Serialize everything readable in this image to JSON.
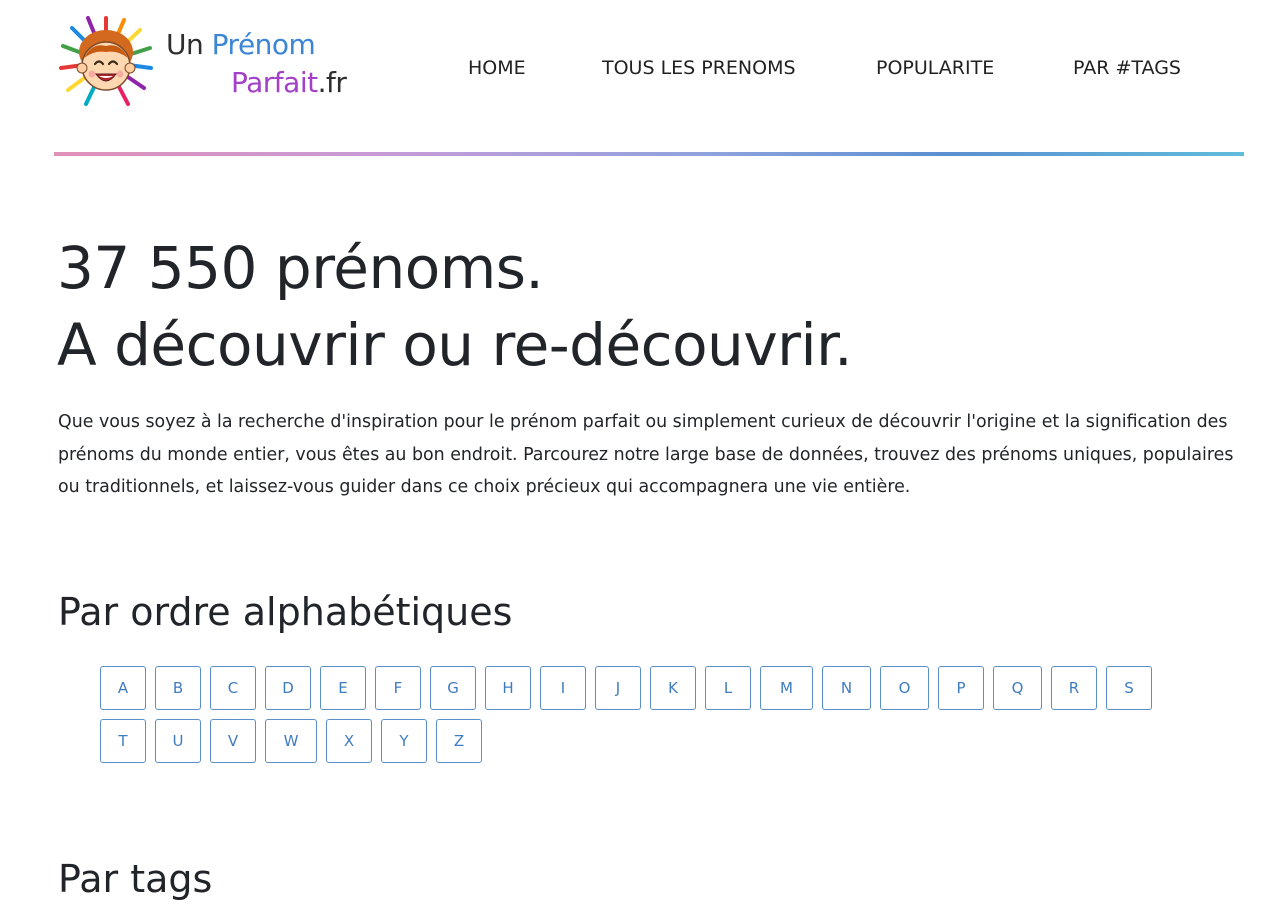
{
  "logo": {
    "line1_a": "Un",
    "line1_b": "Prénom",
    "line2_a": "Parfait",
    "line2_b": ".fr",
    "icon": "smiling-child-face-icon"
  },
  "nav": {
    "items": [
      "HOME",
      "TOUS LES PRENOMS",
      "POPULARITE",
      "PAR #TAGS"
    ]
  },
  "hero": {
    "line1": "37 550 prénoms.",
    "line2": "A découvrir ou re-découvrir."
  },
  "intro": "Que vous soyez à la recherche d'inspiration pour le prénom parfait ou simplement curieux de découvrir l'origine et la signification des prénoms du monde entier, vous êtes au bon endroit. Parcourez notre large base de données, trouvez des prénoms uniques, populaires ou traditionnels, et laissez-vous guider dans ce choix précieux qui accompagnera une vie entière.",
  "alphabet": {
    "title": "Par ordre alphabétiques",
    "row1": [
      "A",
      "B",
      "C",
      "D",
      "E",
      "F",
      "G",
      "H",
      "I",
      "J",
      "K",
      "L",
      "M",
      "N",
      "O",
      "P",
      "Q",
      "R",
      "S"
    ],
    "row2": [
      "T",
      "U",
      "V",
      "W",
      "X",
      "Y",
      "Z"
    ]
  },
  "tags": {
    "title": "Par tags"
  },
  "colors": {
    "text": "#212529",
    "letter_border": "#5a8fc8",
    "letter_text": "#3f7cc0",
    "logo_dark": "#2e2e2e",
    "logo_blue": "#3d86d6",
    "logo_purple": "#a340c8"
  }
}
